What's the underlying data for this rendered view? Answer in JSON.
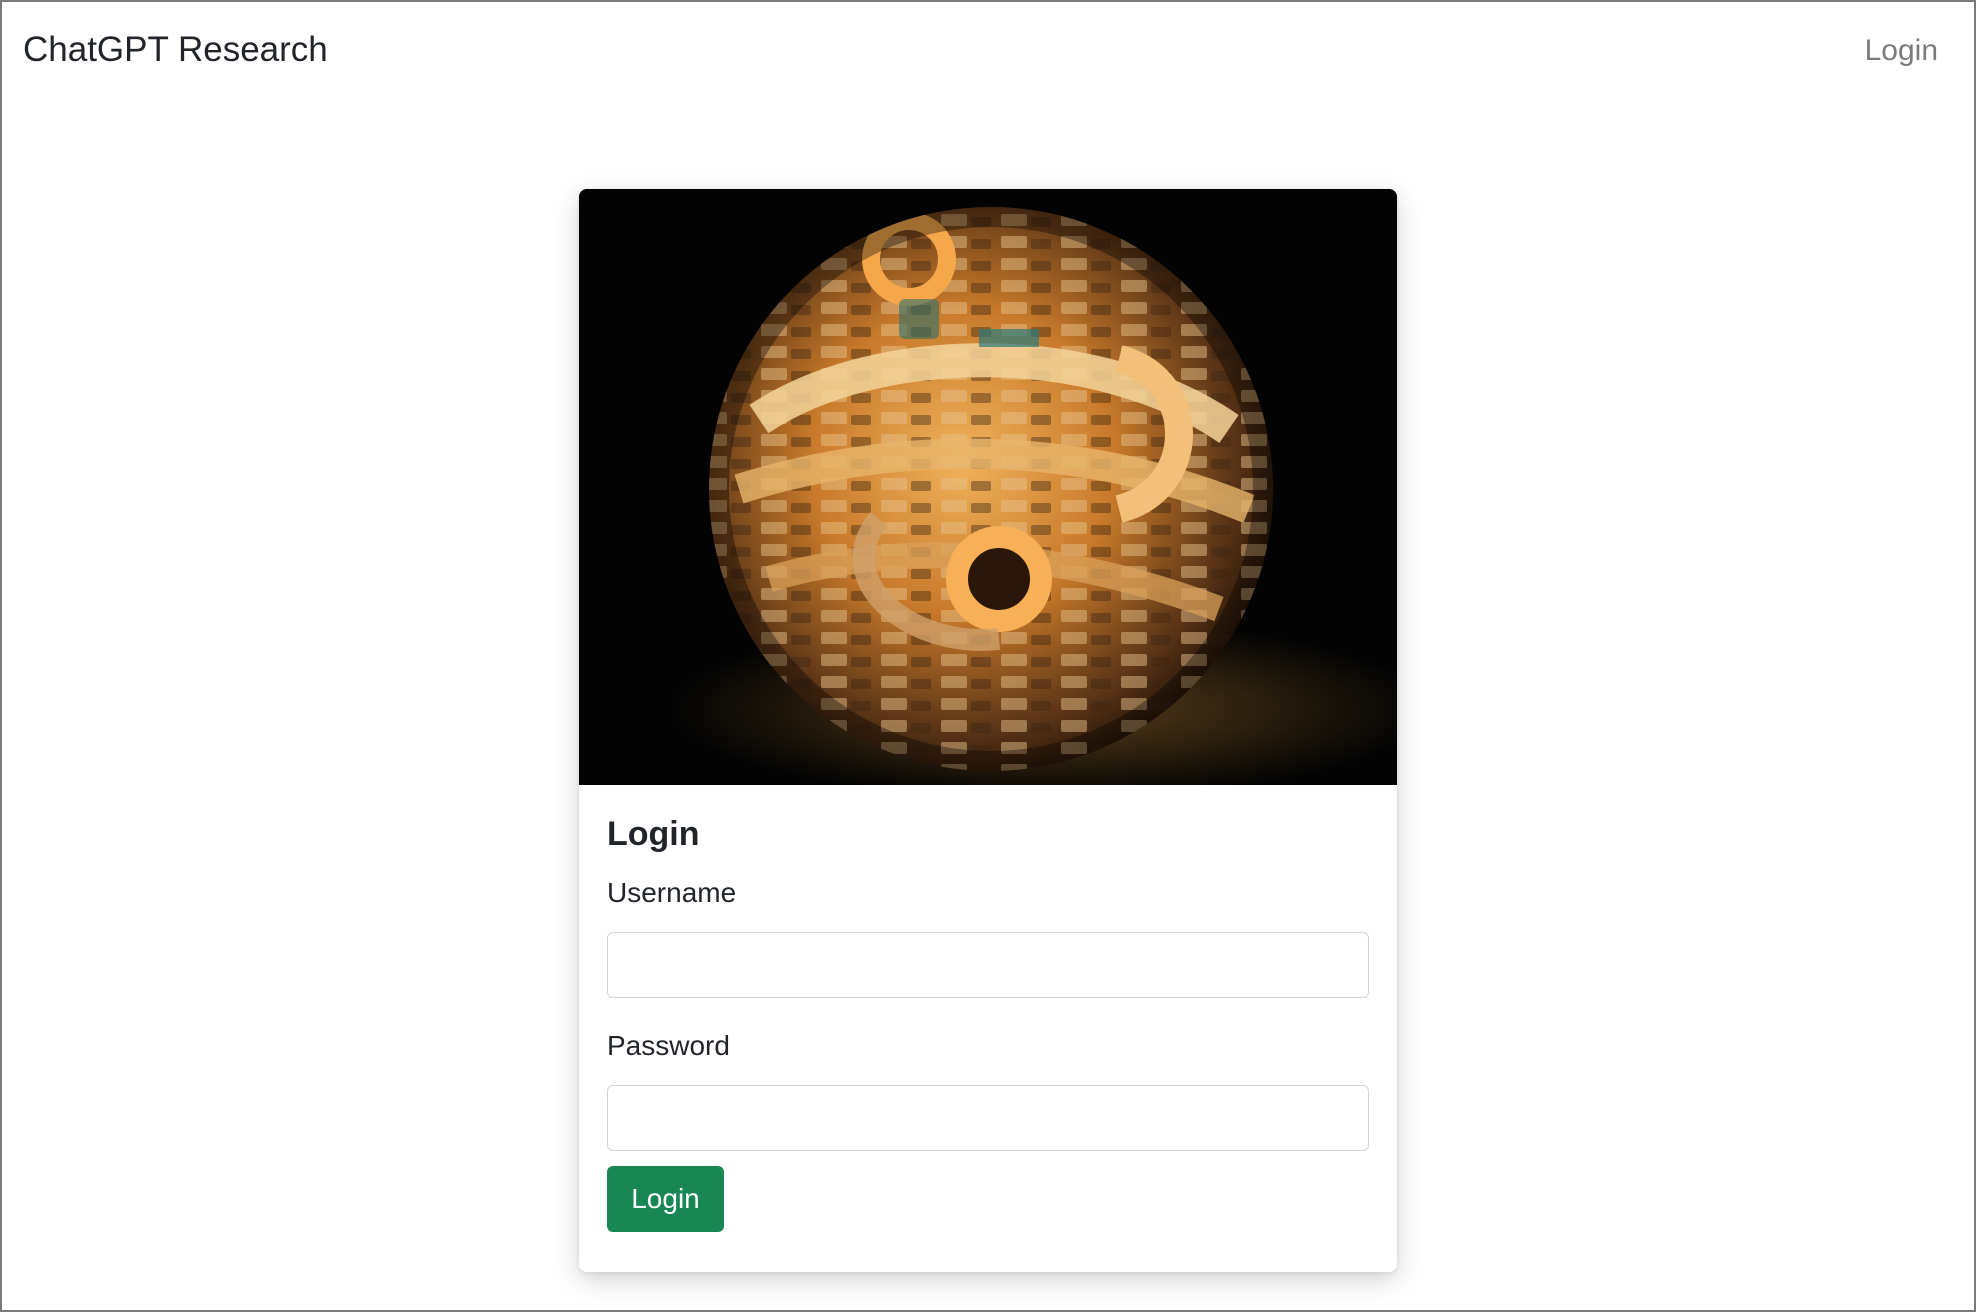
{
  "navbar": {
    "brand": "ChatGPT Research",
    "login_link": "Login"
  },
  "card": {
    "image_icon": "abstract-sphere-image",
    "title": "Login",
    "username_label": "Username",
    "username_value": "",
    "password_label": "Password",
    "password_value": "",
    "submit_label": "Login"
  },
  "colors": {
    "submit_button": "#198754",
    "nav_link": "#7b7b7b",
    "text": "#212529"
  }
}
